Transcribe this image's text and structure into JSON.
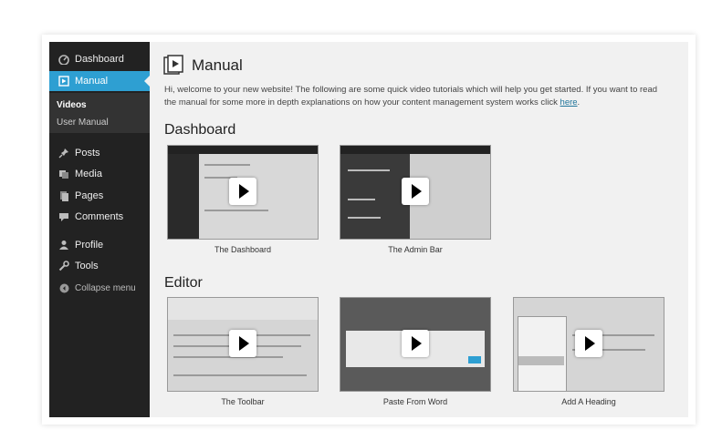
{
  "sidebar": {
    "items": [
      {
        "label": "Dashboard",
        "icon": "dashboard-icon"
      },
      {
        "label": "Manual",
        "icon": "manual-icon"
      },
      {
        "label": "Posts",
        "icon": "pin-icon"
      },
      {
        "label": "Media",
        "icon": "media-icon"
      },
      {
        "label": "Pages",
        "icon": "pages-icon"
      },
      {
        "label": "Comments",
        "icon": "comment-icon"
      },
      {
        "label": "Profile",
        "icon": "user-icon"
      },
      {
        "label": "Tools",
        "icon": "wrench-icon"
      }
    ],
    "submenu": [
      "Videos",
      "User Manual"
    ],
    "collapse_label": "Collapse menu"
  },
  "page": {
    "title": "Manual",
    "intro_text": "Hi, welcome to your new website! The following are some quick video tutorials which will help you get started. If you want to read the manual for some more in depth explanations on how your content management system works click ",
    "intro_link": "here",
    "intro_end": "."
  },
  "sections": [
    {
      "heading": "Dashboard",
      "videos": [
        "The Dashboard",
        "The Admin Bar"
      ]
    },
    {
      "heading": "Editor",
      "videos": [
        "The Toolbar",
        "Paste From Word",
        "Add A Heading"
      ]
    }
  ],
  "colors": {
    "accent": "#2e9fd2",
    "sidebar_bg": "#222222",
    "content_bg": "#f1f1f1"
  }
}
